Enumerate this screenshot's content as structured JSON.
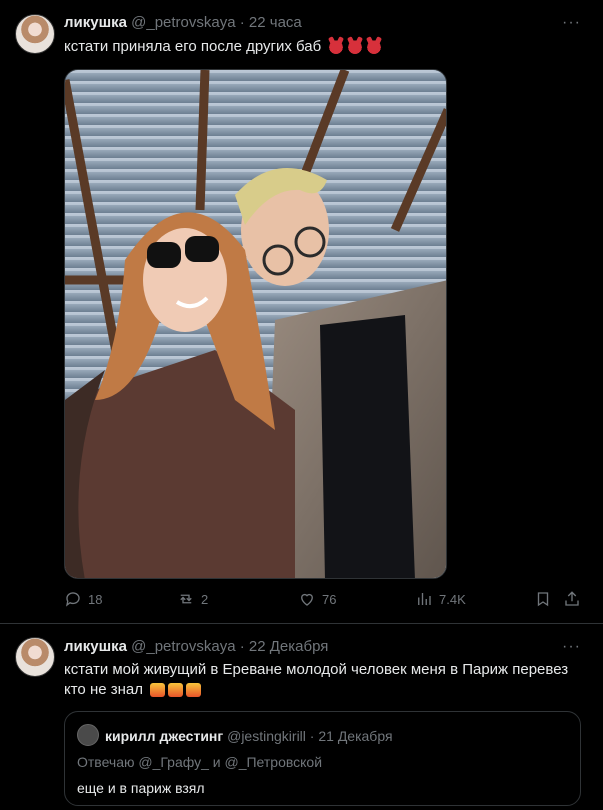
{
  "tweet1": {
    "name": "ликушка",
    "handle": "@_petrovskaya",
    "dot": "·",
    "time": "22 часа",
    "text": "кстати приняла его после других баб",
    "emojis": [
      "devil",
      "devil",
      "devil"
    ],
    "actions": {
      "replies": "18",
      "retweets": "2",
      "likes": "76",
      "views": "7.4K"
    }
  },
  "tweet2": {
    "name": "ликушка",
    "handle": "@_petrovskaya",
    "dot": "·",
    "time": "22 Декабря",
    "text_line1": "кстати мой живущий в Ереване молодой человек меня в Париж перевез",
    "text_line2": "кто не знал",
    "emojis": [
      "fire",
      "fire",
      "fire"
    ],
    "quote": {
      "name": "кирилл джестинг",
      "handle": "@jestingkirill",
      "dot": "·",
      "time": "21 Декабря",
      "reply_prefix": "Отвечаю",
      "reply_user1": "@_Графу_",
      "reply_and": "и",
      "reply_user2": "@_Петровской",
      "text": "еще и в париж взял"
    }
  },
  "more_glyph": "···",
  "colors": {
    "bg": "#000000",
    "text": "#e7e9ea",
    "muted": "#71767b",
    "border": "#2f3336"
  }
}
